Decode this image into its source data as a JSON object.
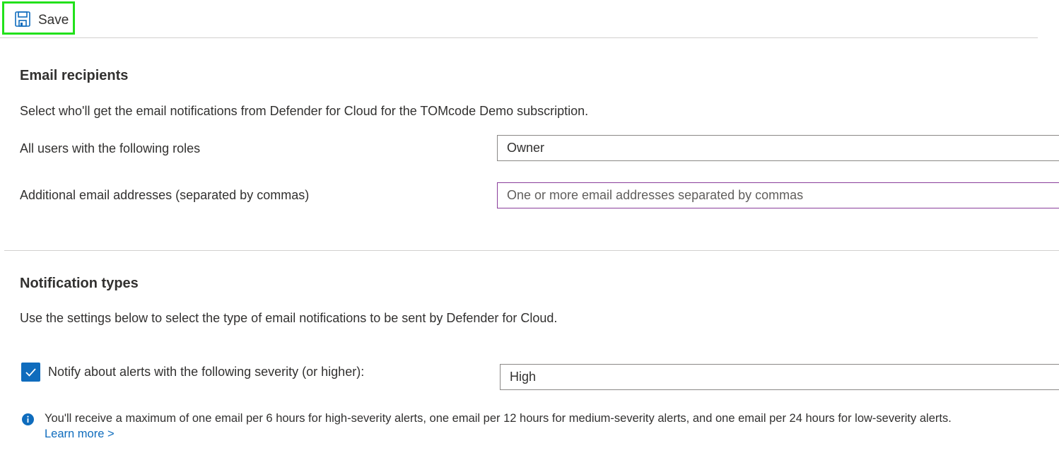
{
  "toolbar": {
    "save_label": "Save",
    "save_icon": "save-icon",
    "highlight_color": "#22e11b"
  },
  "email_recipients": {
    "title": "Email recipients",
    "description": "Select who'll get the email notifications from Defender for Cloud for the TOMcode Demo subscription.",
    "roles_label": "All users with the following roles",
    "roles_value": "Owner",
    "emails_label": "Additional email addresses (separated by commas)",
    "emails_value": "",
    "emails_placeholder": "One or more email addresses separated by commas"
  },
  "notification_types": {
    "title": "Notification types",
    "description": "Use the settings below to select the type of email notifications to be sent by Defender for Cloud.",
    "severity_checkbox_checked": true,
    "severity_label": "Notify about alerts with the following severity (or higher):",
    "severity_value": "High",
    "info_icon": "info-icon",
    "info_text": "You'll receive a maximum of one email per 6 hours for high-severity alerts, one email per 12 hours for medium-severity alerts, and one email per 24 hours for low-severity alerts.",
    "learn_more": "Learn more >"
  },
  "colors": {
    "accent": "#0f6cbd",
    "input_focus_border": "#8a3d9a",
    "text": "#323130"
  }
}
